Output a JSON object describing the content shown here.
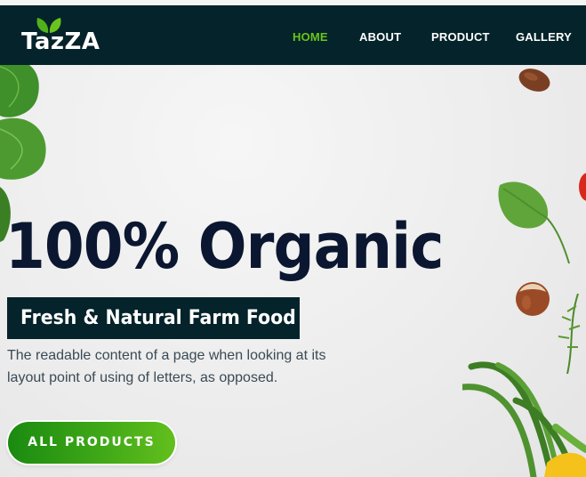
{
  "brand": {
    "logo_text": "TazZA",
    "logo_icon": "leaf-icon",
    "accent": "#6ac41b",
    "navbar_bg": "#04232a",
    "title_color": "#0b1730"
  },
  "nav": {
    "items": [
      {
        "label": "HOME",
        "active": true
      },
      {
        "label": "ABOUT",
        "active": false
      },
      {
        "label": "PRODUCT",
        "active": false
      },
      {
        "label": "GALLERY",
        "active": false
      }
    ]
  },
  "hero": {
    "title": "100% Organic",
    "subtitle": "Fresh & Natural Farm Food",
    "description": "The readable content of a page when looking at its layout point of using of letters, as opposed.",
    "cta_label": "ALL PRODUCTS"
  },
  "decor": {
    "items": [
      "basil-leaves",
      "almond",
      "spinach-leaf",
      "tomato",
      "hazelnut",
      "green-beans",
      "herb-sprig"
    ]
  }
}
